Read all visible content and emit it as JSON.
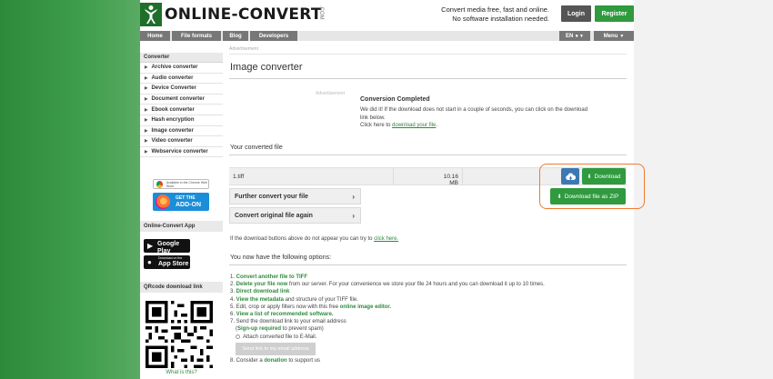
{
  "header": {
    "logo_text": "ONLINE-CONVERT",
    "logo_suffix": ".COM",
    "tagline_line1": "Convert media free, fast and online.",
    "tagline_line2": "No software installation needed.",
    "login_label": "Login",
    "register_label": "Register"
  },
  "nav": {
    "items": [
      "Home",
      "File formats",
      "Blog",
      "Developers"
    ],
    "language": "EN",
    "menu": "Menu"
  },
  "sidebar": {
    "heading": "Converter",
    "items": [
      "Archive converter",
      "Audio converter",
      "Device Converter",
      "Document converter",
      "Ebook converter",
      "Hash encryption",
      "Image converter",
      "Video converter",
      "Webservice converter"
    ],
    "chrome_badge": "Available in the Chrome Web Store",
    "addon_line1": "GET THE",
    "addon_line2": "ADD-ON",
    "app_heading": "Online-Convert App",
    "google_play_small": "GET IT ON",
    "google_play": "Google Play",
    "app_store_small": "Download on the",
    "app_store": "App Store",
    "qr_heading": "QRcode download link",
    "qr_link": "What is this?"
  },
  "main": {
    "ad_label": "Advertisement",
    "title": "Image converter",
    "ad_mid": "Advertisement",
    "conversion_title": "Conversion Completed",
    "conversion_text": "We did it! If the download does not start in a couple of seconds, you can click on the download link below.",
    "click_here": "Click here to",
    "download_link": "download your file",
    "converted_heading": "Your converted file",
    "file_name": "1.tiff",
    "file_size": "10.16 MB",
    "download_label": "Download",
    "zip_label": "Download file as ZIP",
    "further_label": "Further convert your file",
    "original_label": "Convert original file again",
    "fallback_text": "If the download buttons above do not appear you can try to",
    "fallback_link": "click here.",
    "options_heading": "You now have the following options:",
    "opt1": "Convert another file to TIFF",
    "opt2_link": "Delete your file now",
    "opt2_rest": "from our server. For your convenience we store your file 24 hours and you can download it up to 10 times.",
    "opt3": "Direct download link",
    "opt4_link": "View the metadata",
    "opt4_rest": "and structure of your TIFF file.",
    "opt5_text": "Edit, crop or apply filters now with this free",
    "opt5_link": "online image editor.",
    "opt6": "View a list of recommended software.",
    "opt7": "Send the download link to your email address",
    "opt7_signup": "Sign-up required",
    "opt7_spam": "to prevent spam)",
    "attach_label": "Attach converted file to E-Mail.",
    "send_button": "Send link to my email address",
    "opt8_text": "Consider a",
    "opt8_link": "donation",
    "opt8_rest": "to support us"
  },
  "colors": {
    "brand_green": "#2f9a3e",
    "cloud_blue": "#3d78b6",
    "highlight_orange": "#f07a2e"
  }
}
